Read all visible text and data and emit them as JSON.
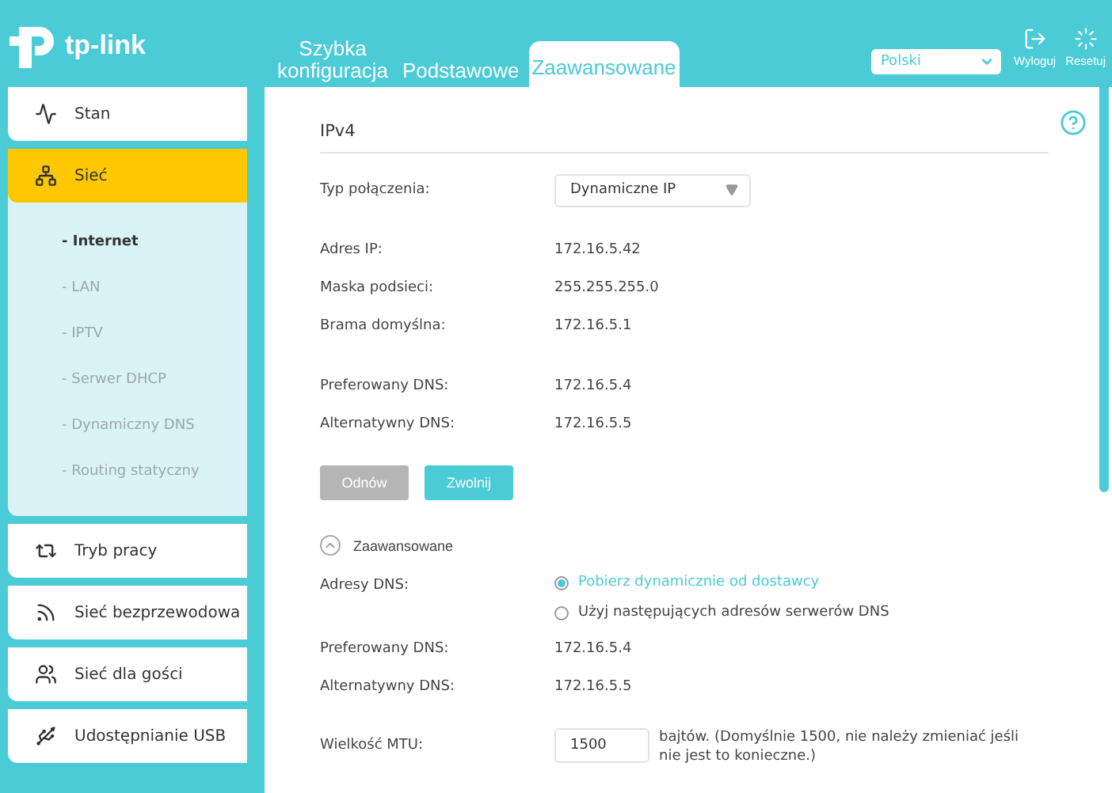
{
  "header": {
    "logo_text": "tp-link",
    "tabs": [
      {
        "label": "Szybka konfiguracja",
        "selected": false
      },
      {
        "label": "Podstawowe",
        "selected": false
      },
      {
        "label": "Zaawansowane",
        "selected": true
      }
    ],
    "language": "Polski",
    "actions": [
      {
        "kind": "logout",
        "label": "Wyloguj"
      },
      {
        "kind": "reset",
        "label": "Resetuj"
      }
    ]
  },
  "sidebar": {
    "items": [
      {
        "kind": "status",
        "label": "Stan",
        "selected": false
      },
      {
        "kind": "network",
        "label": "Sieć",
        "selected": true,
        "expanded": true,
        "children": [
          {
            "label": "- Internet",
            "selected": true
          },
          {
            "label": "- LAN",
            "selected": false
          },
          {
            "label": "- IPTV",
            "selected": false
          },
          {
            "label": "- Serwer DHCP",
            "selected": false
          },
          {
            "label": "- Dynamiczny DNS",
            "selected": false
          },
          {
            "label": "- Routing statyczny",
            "selected": false
          }
        ]
      },
      {
        "kind": "mode",
        "label": "Tryb pracy",
        "selected": false
      },
      {
        "kind": "wireless",
        "label": "Sieć bezprzewodowa",
        "selected": false
      },
      {
        "kind": "guest",
        "label": "Sieć dla gości",
        "selected": false
      },
      {
        "kind": "usb",
        "label": "Udostępnianie USB",
        "selected": false
      }
    ]
  },
  "main": {
    "section_title": "IPv4",
    "connection_type": {
      "label": "Typ połączenia:",
      "value": "Dynamiczne IP"
    },
    "address_rows": [
      {
        "label": "Adres IP:",
        "value": "172.16.5.42"
      },
      {
        "label": "Maska podsieci:",
        "value": "255.255.255.0"
      },
      {
        "label": "Brama domyślna:",
        "value": "172.16.5.1"
      }
    ],
    "current_dns_rows": [
      {
        "label": "Preferowany DNS:",
        "value": "172.16.5.4"
      },
      {
        "label": "Alternatywny DNS:",
        "value": "172.16.5.5"
      }
    ],
    "buttons": [
      {
        "label": "Odnów",
        "disabled": true
      },
      {
        "label": "Zwolnij",
        "disabled": false
      }
    ],
    "advanced": {
      "label": "Zaawansowane",
      "expanded": true
    },
    "dns_mode": {
      "label": "Adresy DNS:",
      "options": [
        {
          "label": "Pobierz dynamicznie od dostawcy",
          "selected": true
        },
        {
          "label": "Użyj następujących adresów serwerów DNS",
          "selected": false
        }
      ]
    },
    "dns_rows": [
      {
        "label": "Preferowany DNS:",
        "value": "172.16.5.4"
      },
      {
        "label": "Alternatywny DNS:",
        "value": "172.16.5.5"
      }
    ],
    "mtu": {
      "label": "Wielkość MTU:",
      "value": "1500",
      "note": "bajtów. (Domyślnie 1500, nie należy zmieniać jeśli nie jest to konieczne.)"
    }
  }
}
